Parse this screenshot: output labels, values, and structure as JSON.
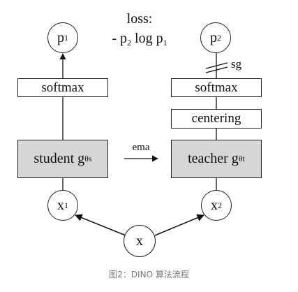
{
  "loss": {
    "title": "loss:",
    "formula_minus": "- p",
    "formula_sub1": "2",
    "formula_mid": " log p",
    "formula_sub2": "1"
  },
  "left": {
    "output": {
      "base": "p",
      "sub": "1"
    },
    "softmax": "softmax",
    "network": {
      "text": "student g",
      "sub": "θs"
    },
    "input": {
      "base": "x",
      "sub": "1"
    }
  },
  "right": {
    "output": {
      "base": "p",
      "sub": "2"
    },
    "stop_gradient": "sg",
    "softmax": "softmax",
    "centering": "centering",
    "network": {
      "text": "teacher g",
      "sub": "θt"
    },
    "input": {
      "base": "x",
      "sub": "2"
    }
  },
  "ema_label": "ema",
  "source": "x",
  "caption": "图2：DINO 算法流程"
}
